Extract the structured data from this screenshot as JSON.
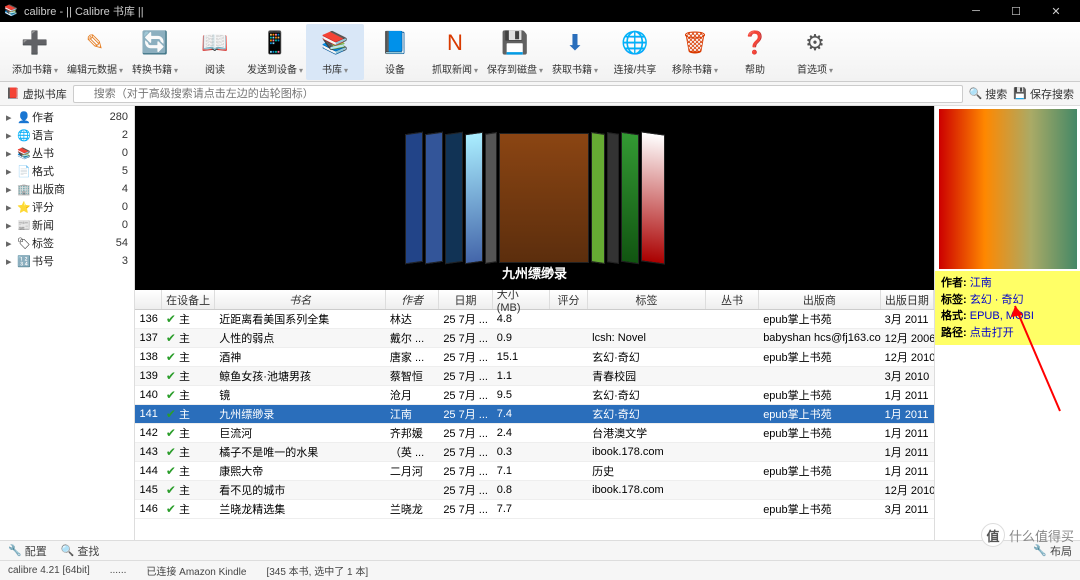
{
  "window": {
    "title": "calibre - || Calibre 书库 ||"
  },
  "toolbar": [
    {
      "label": "添加书籍",
      "icon": "➕",
      "color": "#2a9d2a",
      "dd": true
    },
    {
      "label": "编辑元数据",
      "icon": "✎",
      "color": "#e67e22",
      "dd": true
    },
    {
      "label": "转换书籍",
      "icon": "🔄",
      "color": "#8b5a2b",
      "dd": true
    },
    {
      "label": "阅读",
      "icon": "📖",
      "color": "#1f7a1f",
      "dd": false
    },
    {
      "label": "发送到设备",
      "icon": "📱",
      "color": "#555",
      "dd": true
    },
    {
      "label": "书库",
      "icon": "📚",
      "color": "#8b5a2b",
      "dd": true,
      "active": true
    },
    {
      "label": "设备",
      "icon": "📘",
      "color": "#555",
      "dd": false
    },
    {
      "label": "抓取新闻",
      "icon": "N",
      "color": "#d93a00",
      "dd": true
    },
    {
      "label": "保存到磁盘",
      "icon": "💾",
      "color": "#2a6ebb",
      "dd": true
    },
    {
      "label": "获取书籍",
      "icon": "⬇",
      "color": "#2a6ebb",
      "dd": true
    },
    {
      "label": "连接/共享",
      "icon": "🌐",
      "color": "#2a9d2a",
      "dd": false
    },
    {
      "label": "移除书籍",
      "icon": "🗑",
      "color": "#d93a00",
      "dd": true
    },
    {
      "label": "帮助",
      "icon": "❓",
      "color": "#2a6ebb",
      "dd": false
    },
    {
      "label": "首选项",
      "icon": "⚙",
      "color": "#555",
      "dd": true
    }
  ],
  "virtual_library": "虚拟书库",
  "search": {
    "placeholder": "搜索（对于高级搜索请点击左边的齿轮图标）",
    "go": "搜索",
    "save": "保存搜索"
  },
  "sidebar": [
    {
      "icon": "👤",
      "label": "作者",
      "count": 280
    },
    {
      "icon": "🌐",
      "label": "语言",
      "count": 2
    },
    {
      "icon": "📚",
      "label": "丛书",
      "count": 0
    },
    {
      "icon": "📄",
      "label": "格式",
      "count": 5
    },
    {
      "icon": "🏢",
      "label": "出版商",
      "count": 4
    },
    {
      "icon": "⭐",
      "label": "评分",
      "count": 0
    },
    {
      "icon": "📰",
      "label": "新闻",
      "count": 0
    },
    {
      "icon": "🏷",
      "label": "标签",
      "count": 54
    },
    {
      "icon": "🔢",
      "label": "书号",
      "count": 3
    }
  ],
  "coverflow_title": "九州缥缈录",
  "columns": [
    "",
    "在设备上",
    "书名",
    "作者",
    "日期",
    "大小 (MB)",
    "评分",
    "标签",
    "丛书",
    "出版商",
    "出版日期"
  ],
  "rows": [
    {
      "n": 136,
      "dev": "主",
      "title": "近距离看美国系列全集",
      "author": "林达",
      "date": "25 7月 ...",
      "size": "4.8",
      "tags": "",
      "pub": "epub掌上书苑",
      "pubdate": "3月 2011"
    },
    {
      "n": 137,
      "dev": "主",
      "title": "人性的弱点",
      "author": "戴尔 ...",
      "date": "25 7月 ...",
      "size": "0.9",
      "tags": "lcsh: Novel",
      "pub": "babyshan hcs@fj163.com",
      "pubdate": "12月 2006"
    },
    {
      "n": 138,
      "dev": "主",
      "title": "酒神",
      "author": "唐家 ...",
      "date": "25 7月 ...",
      "size": "15.1",
      "tags": "玄幻·奇幻",
      "pub": "epub掌上书苑",
      "pubdate": "12月 2010"
    },
    {
      "n": 139,
      "dev": "主",
      "title": "鲸鱼女孩·池塘男孩",
      "author": "蔡智恒",
      "date": "25 7月 ...",
      "size": "1.1",
      "tags": "青春校园",
      "pub": "",
      "pubdate": "3月 2010"
    },
    {
      "n": 140,
      "dev": "主",
      "title": "镜",
      "author": "沧月",
      "date": "25 7月 ...",
      "size": "9.5",
      "tags": "玄幻·奇幻",
      "pub": "epub掌上书苑",
      "pubdate": "1月 2011"
    },
    {
      "n": 141,
      "dev": "主",
      "title": "九州缥缈录",
      "author": "江南",
      "date": "25 7月 ...",
      "size": "7.4",
      "tags": "玄幻·奇幻",
      "pub": "epub掌上书苑",
      "pubdate": "1月 2011",
      "sel": true
    },
    {
      "n": 142,
      "dev": "主",
      "title": "巨流河",
      "author": "齐邦媛",
      "date": "25 7月 ...",
      "size": "2.4",
      "tags": "台港澳文学",
      "pub": "epub掌上书苑",
      "pubdate": "1月 2011"
    },
    {
      "n": 143,
      "dev": "主",
      "title": "橘子不是唯一的水果",
      "author": "（英 ...",
      "date": "25 7月 ...",
      "size": "0.3",
      "tags": "ibook.178.com",
      "pub": "",
      "pubdate": "1月 2011"
    },
    {
      "n": 144,
      "dev": "主",
      "title": "康熙大帝",
      "author": "二月河",
      "date": "25 7月 ...",
      "size": "7.1",
      "tags": "历史",
      "pub": "epub掌上书苑",
      "pubdate": "1月 2011"
    },
    {
      "n": 145,
      "dev": "主",
      "title": "看不见的城市",
      "author": "",
      "date": "25 7月 ...",
      "size": "0.8",
      "tags": "ibook.178.com",
      "pub": "",
      "pubdate": "12月 2010"
    },
    {
      "n": 146,
      "dev": "主",
      "title": "兰晓龙精选集",
      "author": "兰晓龙",
      "date": "25 7月 ...",
      "size": "7.7",
      "tags": "",
      "pub": "epub掌上书苑",
      "pubdate": "3月 2011"
    }
  ],
  "details": {
    "author_k": "作者:",
    "author_v": "江南",
    "tags_k": "标签:",
    "tags_v": "玄幻 · 奇幻",
    "format_k": "格式:",
    "format_v": "EPUB, MOBI",
    "path_k": "路径:",
    "path_v": "点击打开"
  },
  "footer": {
    "config": "配置",
    "find": "查找",
    "version": "calibre 4.21 [64bit]",
    "conn": "已连接 Amazon Kindle",
    "count": "[345 本书, 选中了 1 本]",
    "layout": "布局"
  },
  "watermark": "什么值得买"
}
